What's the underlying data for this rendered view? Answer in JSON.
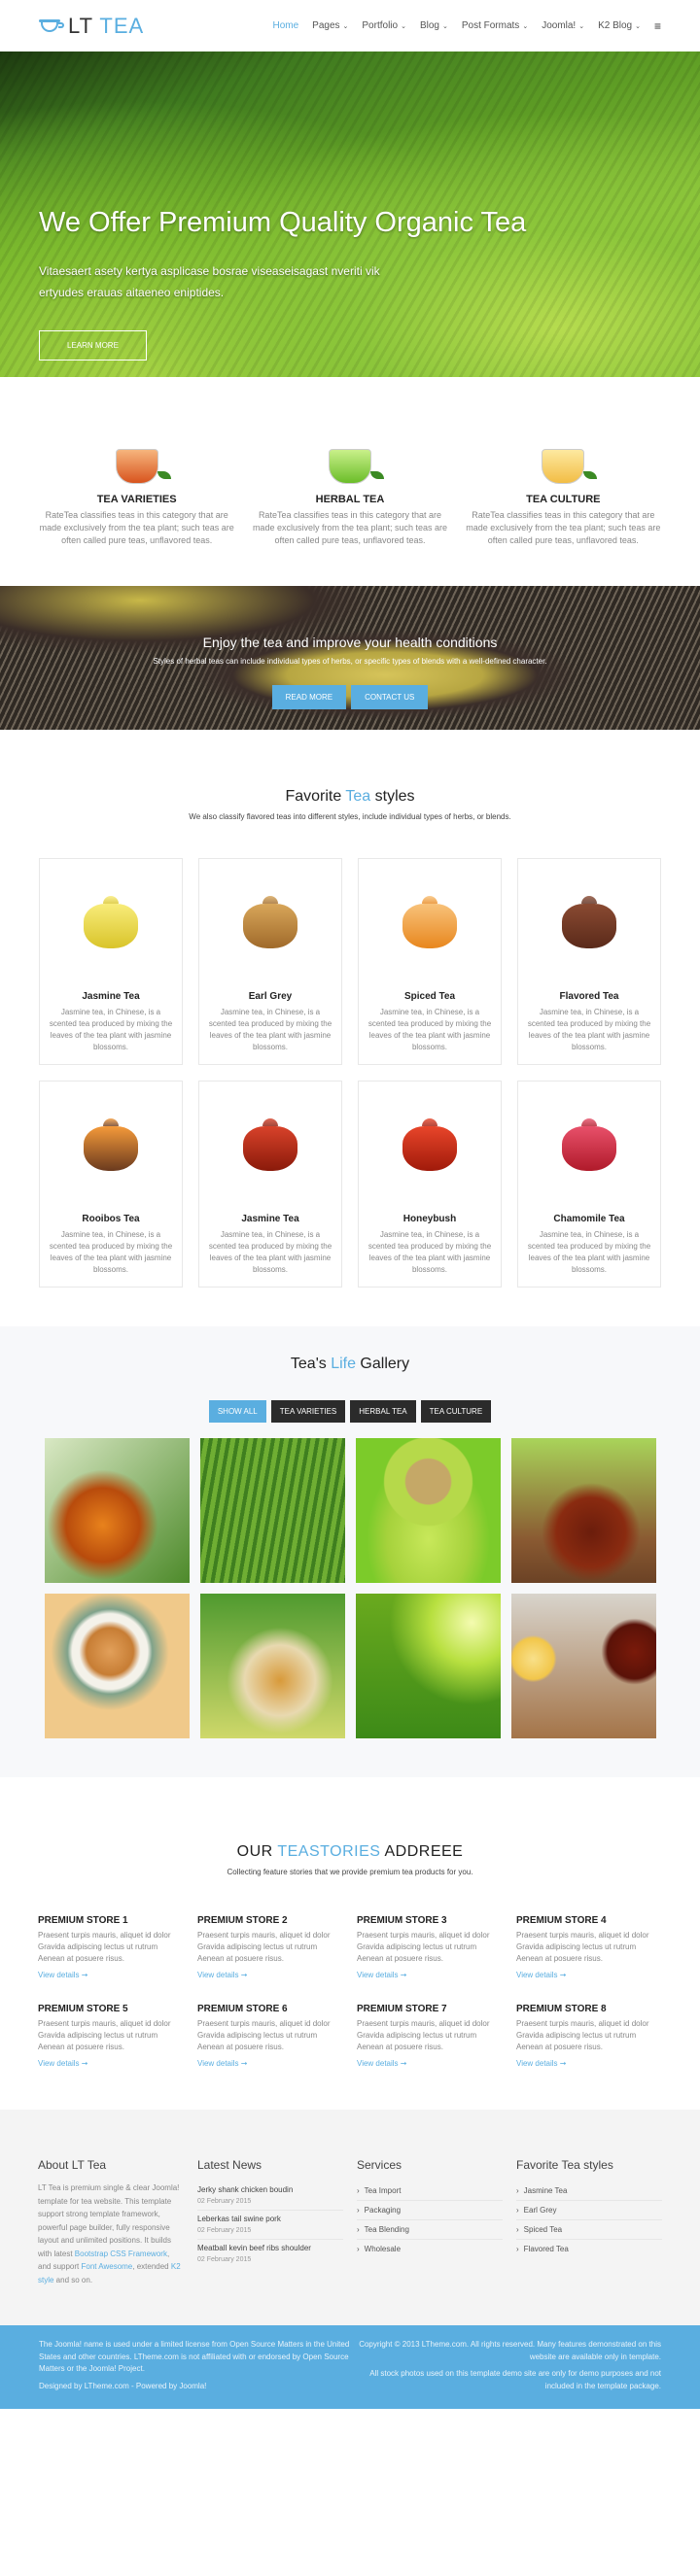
{
  "header": {
    "logo": {
      "lt": "LT",
      "tea": "TEA"
    },
    "nav": [
      {
        "label": "Home",
        "active": true,
        "dropdown": false
      },
      {
        "label": "Pages",
        "dropdown": true
      },
      {
        "label": "Portfolio",
        "dropdown": true
      },
      {
        "label": "Blog",
        "dropdown": true
      },
      {
        "label": "Post Formats",
        "dropdown": true
      },
      {
        "label": "Joomla!",
        "dropdown": true
      },
      {
        "label": "K2 Blog",
        "dropdown": true
      }
    ],
    "chevron": "⌄",
    "menu_icon": "≡"
  },
  "hero": {
    "title": "We Offer Premium Quality Organic Tea",
    "subtitle": "Vitaesaert asety kertya asplicase bosrae viseaseisagast nveriti vik ertyudes erauas aitaeneo eniptides.",
    "button": "LEARN MORE"
  },
  "features": [
    {
      "title": "TEA VARIETIES",
      "text": "RateTea classifies teas in this category that are made exclusively from the tea plant; such teas are often called pure teas, unflavored teas."
    },
    {
      "title": "HERBAL TEA",
      "text": "RateTea classifies teas in this category that are made exclusively from the tea plant; such teas are often called pure teas, unflavored teas."
    },
    {
      "title": "TEA CULTURE",
      "text": "RateTea classifies teas in this category that are made exclusively from the tea plant; such teas are often called pure teas, unflavored teas."
    }
  ],
  "cta": {
    "title": "Enjoy the tea and improve your health conditions",
    "subtitle": "Styles of herbal teas can include individual types of herbs, or specific types of blends with a well-defined character.",
    "read_more": "READ MORE",
    "contact": "CONTACT US"
  },
  "favorite": {
    "title_pre": "Favorite ",
    "title_accent": "Tea",
    "title_post": " styles",
    "subtitle": "We also classify flavored teas into different styles, include individual types of herbs, or blends.",
    "items": [
      {
        "title": "Jasmine Tea",
        "text": "Jasmine tea, in Chinese, is a scented tea produced by mixing the leaves of the tea plant with jasmine blossoms."
      },
      {
        "title": "Earl Grey",
        "text": "Jasmine tea, in Chinese, is a scented tea produced by mixing the leaves of the tea plant with jasmine blossoms."
      },
      {
        "title": "Spiced Tea",
        "text": "Jasmine tea, in Chinese, is a scented tea produced by mixing the leaves of the tea plant with jasmine blossoms."
      },
      {
        "title": "Flavored Tea",
        "text": "Jasmine tea, in Chinese, is a scented tea produced by mixing the leaves of the tea plant with jasmine blossoms."
      },
      {
        "title": "Rooibos Tea",
        "text": "Jasmine tea, in Chinese, is a scented tea produced by mixing the leaves of the tea plant with jasmine blossoms."
      },
      {
        "title": "Jasmine Tea",
        "text": "Jasmine tea, in Chinese, is a scented tea produced by mixing the leaves of the tea plant with jasmine blossoms."
      },
      {
        "title": "Honeybush",
        "text": "Jasmine tea, in Chinese, is a scented tea produced by mixing the leaves of the tea plant with jasmine blossoms."
      },
      {
        "title": "Chamomile Tea",
        "text": "Jasmine tea, in Chinese, is a scented tea produced by mixing the leaves of the tea plant with jasmine blossoms."
      }
    ]
  },
  "gallery": {
    "title_pre": "Tea's ",
    "title_accent": "Life",
    "title_post": " Gallery",
    "filters": [
      "SHOW ALL",
      "TEA VARIETIES",
      "HERBAL TEA",
      "TEA CULTURE"
    ],
    "active_filter": "SHOW ALL"
  },
  "stories": {
    "title_pre": "OUR ",
    "title_accent": "TEASTORIES",
    "title_post": " ADDREEE",
    "subtitle": "Collecting feature stories that we provide premium tea products for you.",
    "link_label": "View details",
    "arrow": "➞",
    "items": [
      {
        "title": "PREMIUM STORE 1",
        "text": "Praesent turpis mauris, aliquet id dolor Gravida adipiscing lectus ut rutrum Aenean at posuere risus."
      },
      {
        "title": "PREMIUM STORE 2",
        "text": "Praesent turpis mauris, aliquet id dolor Gravida adipiscing lectus ut rutrum Aenean at posuere risus."
      },
      {
        "title": "PREMIUM STORE 3",
        "text": "Praesent turpis mauris, aliquet id dolor Gravida adipiscing lectus ut rutrum Aenean at posuere risus."
      },
      {
        "title": "PREMIUM STORE 4",
        "text": "Praesent turpis mauris, aliquet id dolor Gravida adipiscing lectus ut rutrum Aenean at posuere risus."
      },
      {
        "title": "PREMIUM STORE 5",
        "text": "Praesent turpis mauris, aliquet id dolor Gravida adipiscing lectus ut rutrum Aenean at posuere risus."
      },
      {
        "title": "PREMIUM STORE 6",
        "text": "Praesent turpis mauris, aliquet id dolor Gravida adipiscing lectus ut rutrum Aenean at posuere risus."
      },
      {
        "title": "PREMIUM STORE 7",
        "text": "Praesent turpis mauris, aliquet id dolor Gravida adipiscing lectus ut rutrum Aenean at posuere risus."
      },
      {
        "title": "PREMIUM STORE 8",
        "text": "Praesent turpis mauris, aliquet id dolor Gravida adipiscing lectus ut rutrum Aenean at posuere risus."
      }
    ]
  },
  "footer": {
    "about": {
      "title": "About LT Tea",
      "text1": "LT Tea is premium single & clear Joomla! template for tea website. This template support strong template framework, powerful page builder, fully responsive layout and unlimited positions. It builds with latest ",
      "link1": "Bootstrap CSS Framework",
      "text2": ", and support ",
      "link2": "Font Awesome",
      "text3": ", extended ",
      "link3": "K2 style",
      "text4": " and so on."
    },
    "news": {
      "title": "Latest News",
      "items": [
        {
          "title": "Jerky shank chicken boudin",
          "date": "02 February 2015"
        },
        {
          "title": "Leberkas tail swine pork",
          "date": "02 February 2015"
        },
        {
          "title": "Meatball kevin beef ribs shoulder",
          "date": "02 February 2015"
        }
      ]
    },
    "services": {
      "title": "Services",
      "items": [
        "Tea Import",
        "Packaging",
        "Tea Blending",
        "Wholesale"
      ]
    },
    "styles": {
      "title": "Favorite Tea styles",
      "items": [
        "Jasmine Tea",
        "Earl Grey",
        "Spiced Tea",
        "Flavored Tea"
      ]
    },
    "chevron": "›",
    "bottom_left": [
      "The Joomla! name is used under a limited license from Open Source Matters in the United States and other countries. LTheme.com is not affiliated with or endorsed by Open Source Matters or the Joomla! Project.",
      "Designed by LTheme.com - Powered by Joomla!"
    ],
    "bottom_right": [
      "Copyright © 2013 LTheme.com. All rights reserved. Many features demonstrated on this website are available only in template.",
      "All stock photos used on this template demo site are only for demo purposes and not included in the template package."
    ]
  },
  "colors": {
    "accent": "#5aaee0",
    "dark_button": "#2b2b2b",
    "footer_bg": "#f4f4f4"
  }
}
